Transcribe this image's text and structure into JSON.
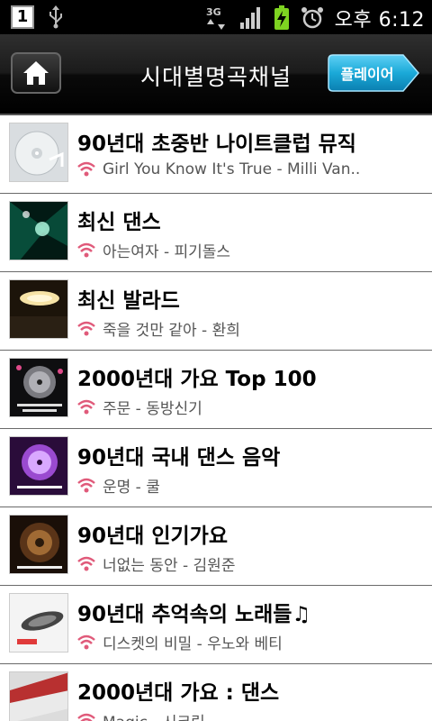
{
  "status_bar": {
    "notification": "1",
    "network": "3G",
    "time": "오후 6:12"
  },
  "header": {
    "title": "시대별명곡채널",
    "player_label": "플레이어"
  },
  "colors": {
    "accent_player": "#1aa9d8",
    "wifi_icon": "#e05a7a",
    "battery": "#7ed321"
  },
  "channels": [
    {
      "title": "90년대 초중반 나이트클럽 뮤직",
      "song": "Girl You Know It's True - Milli Van.."
    },
    {
      "title": "최신 댄스",
      "song": "아는여자 - 피기돌스"
    },
    {
      "title": "최신 발라드",
      "song": "죽을 것만 같아 - 환희"
    },
    {
      "title": "2000년대 가요 Top 100",
      "song": "주문 - 동방신기"
    },
    {
      "title": "90년대 국내 댄스 음악",
      "song": "운명 - 쿨"
    },
    {
      "title": "90년대 인기가요",
      "song": "너없는 동안 - 김원준"
    },
    {
      "title": "90년대 추억속의 노래들♫",
      "song": "디스켓의 비밀 - 우노와 베티"
    },
    {
      "title": "2000년대 가요 : 댄스",
      "song": "Magic - 시크릿"
    }
  ]
}
